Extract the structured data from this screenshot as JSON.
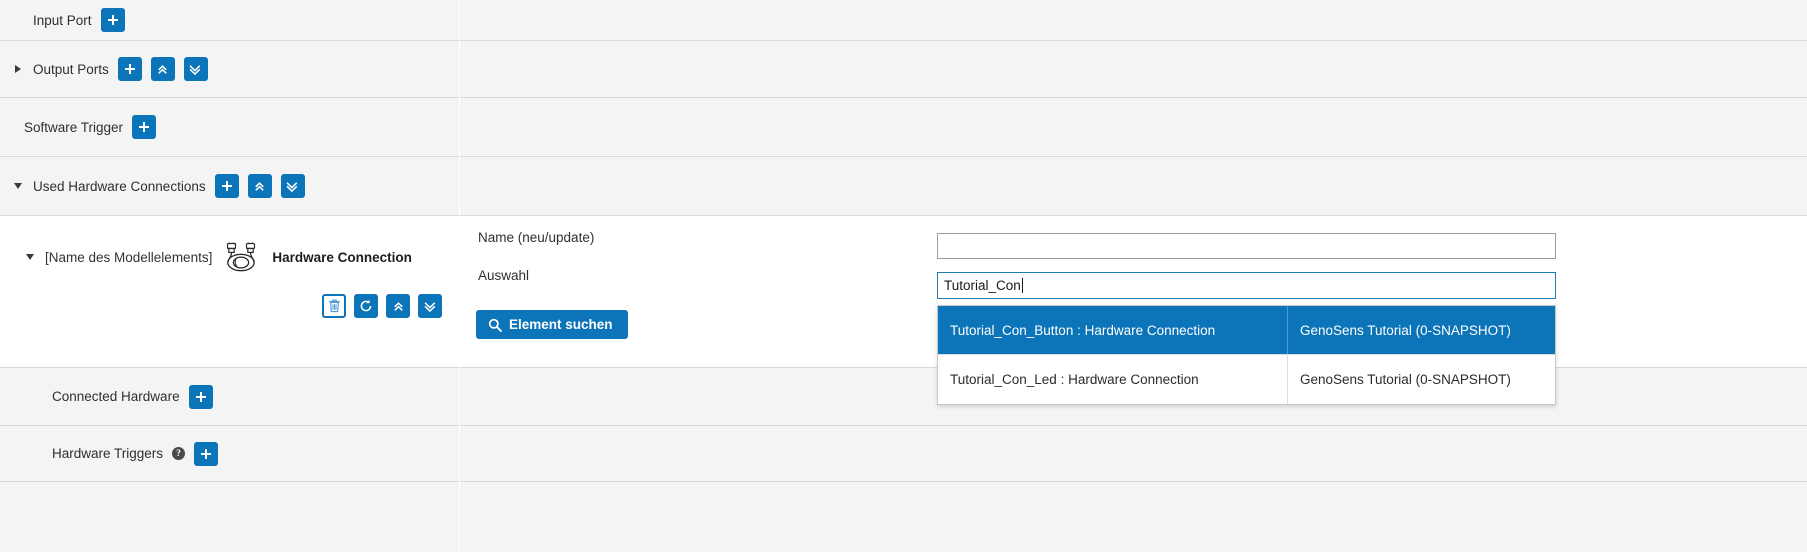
{
  "tree": {
    "nodes": [
      {
        "label": "Input Port",
        "twisty": "none",
        "buttons": [
          "add"
        ]
      },
      {
        "label": "Output Ports",
        "twisty": "right",
        "buttons": [
          "add",
          "collapse-all",
          "expand-all"
        ]
      },
      {
        "label": "Software Trigger",
        "twisty": "none",
        "buttons": [
          "add"
        ]
      },
      {
        "label": "Used Hardware Connections",
        "twisty": "down",
        "buttons": [
          "add",
          "collapse-all",
          "expand-all"
        ]
      },
      {
        "label": "Connected Hardware",
        "twisty": "none",
        "buttons": [
          "add"
        ]
      },
      {
        "label": "Hardware Triggers",
        "twisty": "none",
        "buttons": [
          "add"
        ],
        "help": "?"
      }
    ],
    "hardware_connection_node": {
      "twisty": "down",
      "element_name": "[Name des Modellelements]",
      "type_label": "Hardware Connection",
      "icon": "cable-plug-icon",
      "actions": [
        "delete",
        "reset",
        "collapse",
        "expand"
      ]
    }
  },
  "form": {
    "name_label": "Name (neu/update)",
    "name_value": "",
    "name_placeholder": "",
    "auswahl_label": "Auswahl",
    "auswahl_value": "Tutorial_Con",
    "auswahl_placeholder": "",
    "search_button_label": "Element suchen",
    "search_button_icon": "search-icon"
  },
  "autocomplete": {
    "columns": [
      "element",
      "project"
    ],
    "rows": [
      {
        "element": "Tutorial_Con_Button : Hardware Connection",
        "project": "GenoSens Tutorial (0-SNAPSHOT)",
        "selected": true
      },
      {
        "element": "Tutorial_Con_Led : Hardware Connection",
        "project": "GenoSens Tutorial (0-SNAPSHOT)",
        "selected": false
      }
    ]
  },
  "colors": {
    "accent": "#0c74b8",
    "row_bg": "#f4f4f4",
    "border": "#d8d8d8",
    "selected_row": "#0c74b8",
    "focus_border": "#1e7ab8"
  },
  "icons": {
    "add": "plus-icon",
    "collapse_all": "double-chevron-up-icon",
    "expand_all": "double-chevron-down-icon",
    "delete": "trash-icon",
    "reset": "undo-icon"
  }
}
